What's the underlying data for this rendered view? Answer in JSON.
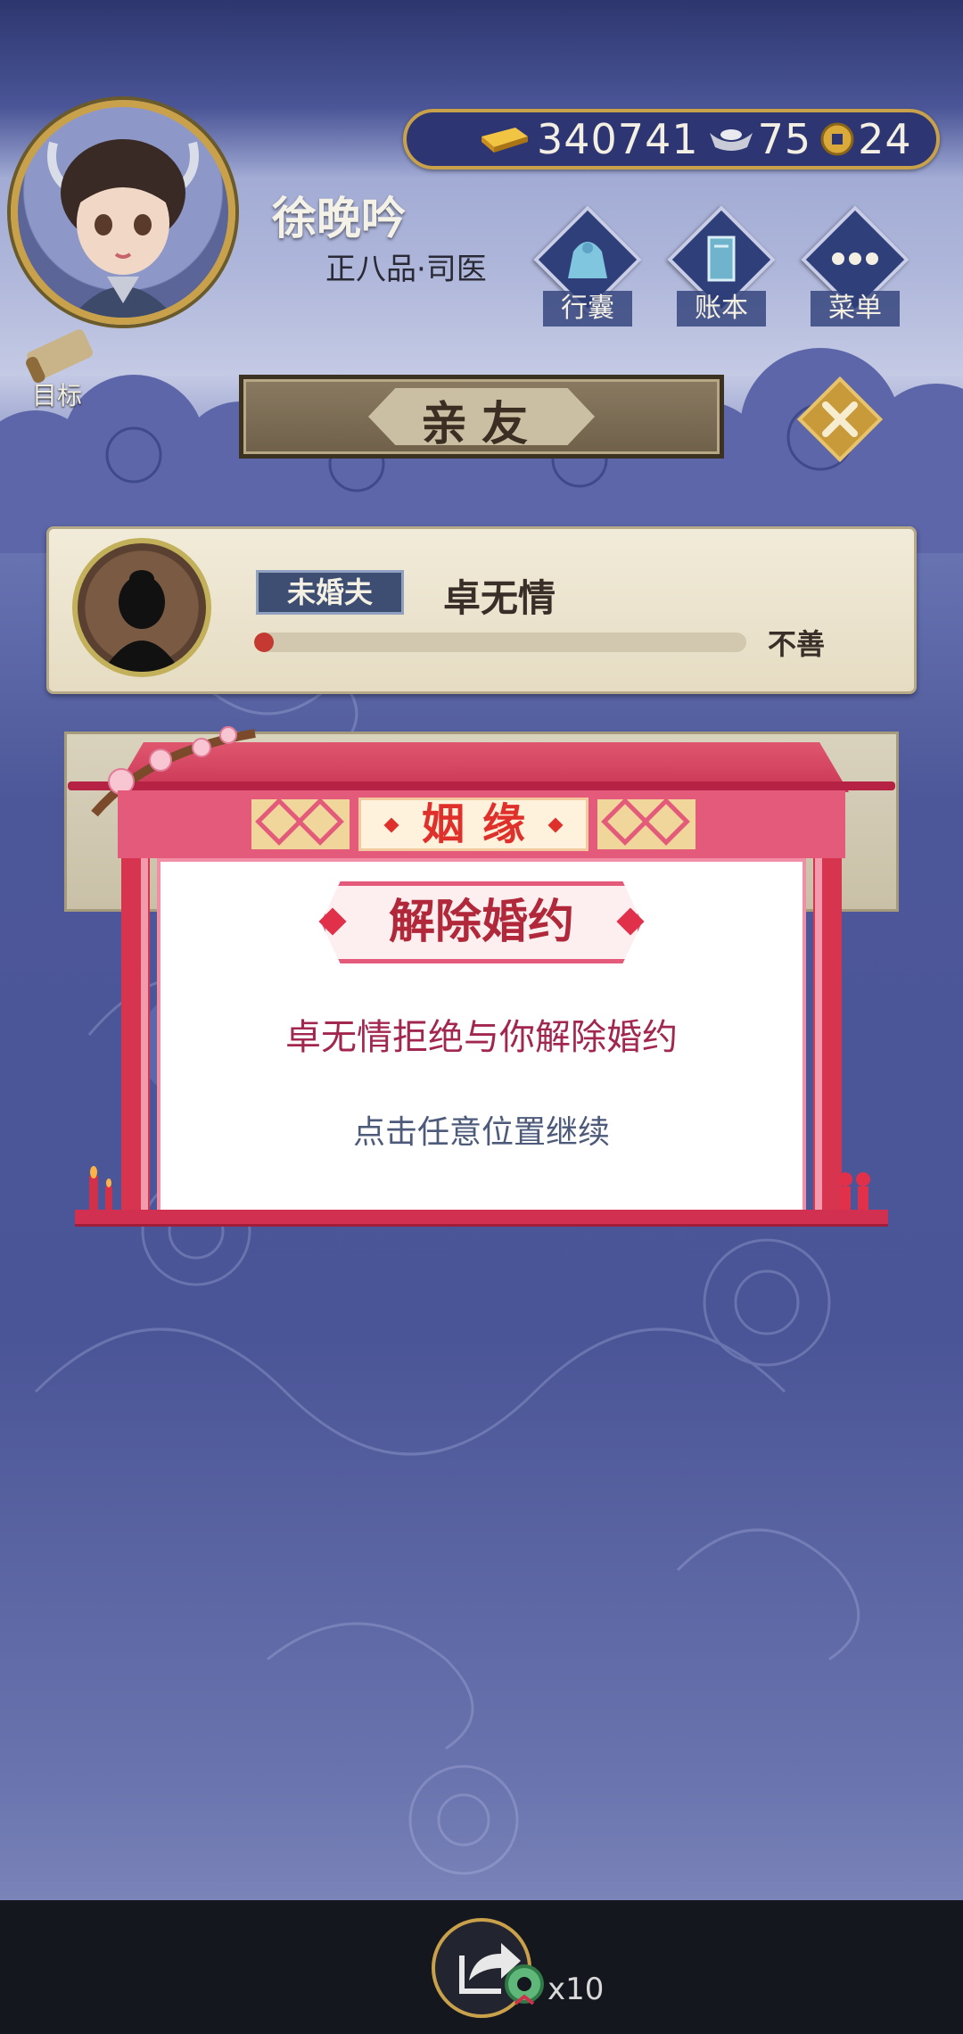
{
  "player": {
    "name": "徐晚吟",
    "rank": "正八品·司医"
  },
  "resources": {
    "gold": "340741",
    "silver": "75",
    "coins": "24"
  },
  "menu": {
    "bag": "行囊",
    "ledger": "账本",
    "menu": "菜单",
    "target": "目标"
  },
  "page_title": "亲友",
  "friend": {
    "relation": "未婚夫",
    "name": "卓无情",
    "favor_label": "不善",
    "favor_level": 0.02
  },
  "dialog": {
    "header": "姻缘",
    "title": "解除婚约",
    "message": "卓无情拒绝与你解除婚约",
    "hint": "点击任意位置继续"
  },
  "share": {
    "count": "x10"
  },
  "colors": {
    "accent_red": "#e0302c",
    "frame_pink": "#e35a7a",
    "background_blue": "#4a5597",
    "gold_frame": "#c9a14a"
  }
}
